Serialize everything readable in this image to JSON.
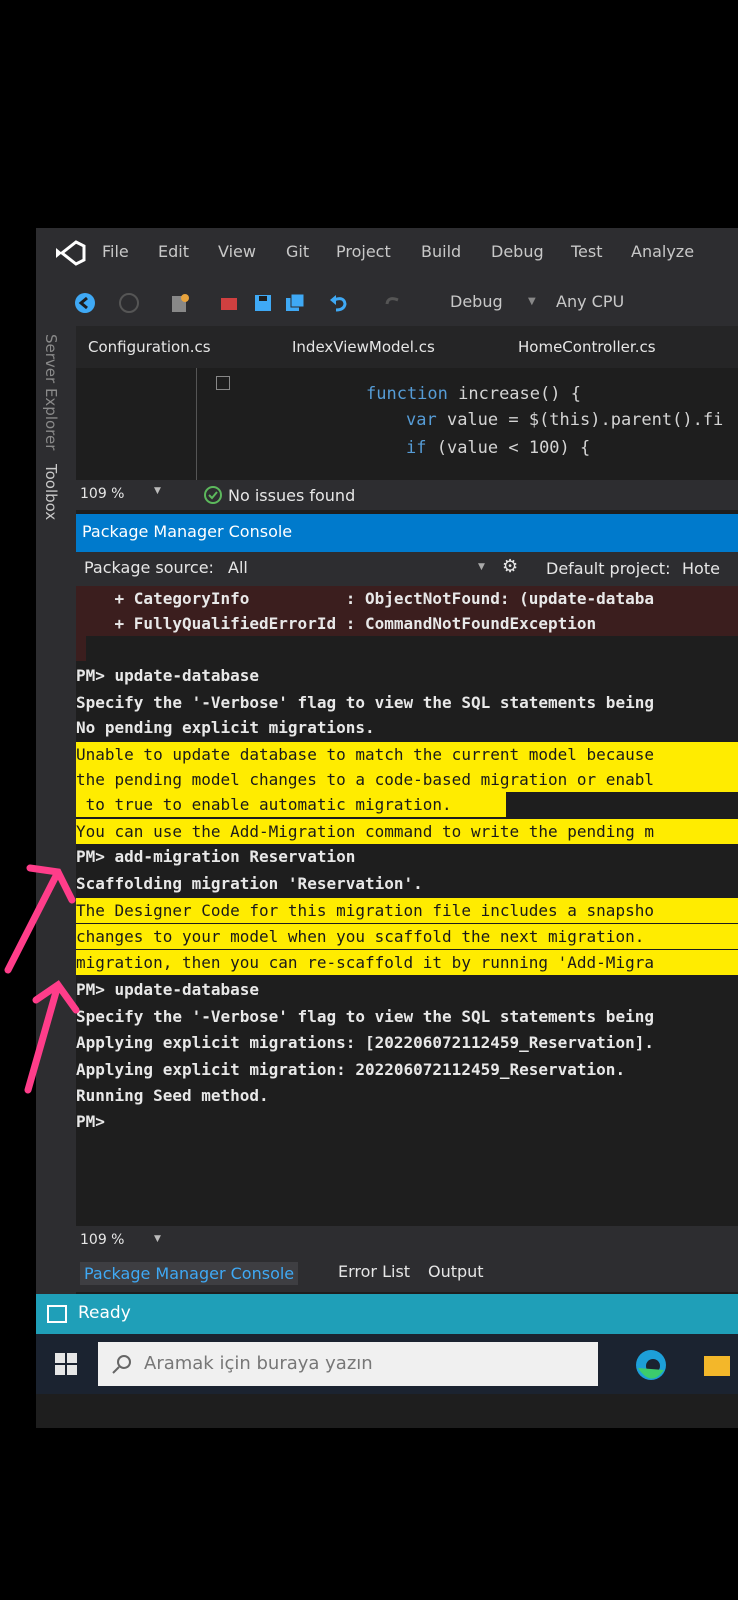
{
  "menu": [
    "File",
    "Edit",
    "View",
    "Git",
    "Project",
    "Build",
    "Debug",
    "Test",
    "Analyze"
  ],
  "toolbar": {
    "config": "Debug",
    "platform": "Any CPU"
  },
  "left_strip": {
    "server_explorer": "Server Explorer",
    "toolbox": "Toolbox"
  },
  "doc_tabs": [
    "Configuration.cs",
    "IndexViewModel.cs",
    "HomeController.cs"
  ],
  "code": {
    "line1": {
      "kw": "function",
      "rest": " increase() {"
    },
    "line2": {
      "kw": "var",
      "rest": " value = $(this).parent().fi"
    },
    "line3": {
      "kw": "if",
      "rest": " (value < 100) {"
    }
  },
  "editor_status": {
    "zoom": "109 %",
    "issues": "No issues found"
  },
  "pmc": {
    "title": "Package Manager Console",
    "source_label": "Package source:",
    "source_value": "All",
    "default_project_label": "Default project:",
    "default_project_value": "Hote"
  },
  "console_lines": [
    {
      "kind": "err",
      "text": "    + CategoryInfo          : ObjectNotFound: (update-databa"
    },
    {
      "kind": "err",
      "text": "    + FullyQualifiedErrorId : CommandNotFoundException"
    },
    {
      "kind": "err",
      "text": " "
    },
    {
      "kind": "norm",
      "text": "PM> update-database"
    },
    {
      "kind": "norm",
      "text": "Specify the '-Verbose' flag to view the SQL statements being"
    },
    {
      "kind": "norm",
      "text": "No pending explicit migrations."
    },
    {
      "kind": "warn",
      "text": "Unable to update database to match the current model because"
    },
    {
      "kind": "warn",
      "text": "the pending model changes to a code-based migration or enabl"
    },
    {
      "kind": "warn",
      "text": " to true to enable automatic migration."
    },
    {
      "kind": "warn",
      "text": "You can use the Add-Migration command to write the pending m"
    },
    {
      "kind": "norm",
      "text": "PM> add-migration Reservation"
    },
    {
      "kind": "norm",
      "text": "Scaffolding migration 'Reservation'."
    },
    {
      "kind": "warn",
      "text": "The Designer Code for this migration file includes a snapsho"
    },
    {
      "kind": "warn",
      "text": "changes to your model when you scaffold the next migration."
    },
    {
      "kind": "warn",
      "text": "migration, then you can re-scaffold it by running 'Add-Migra"
    },
    {
      "kind": "norm",
      "text": "PM> update-database"
    },
    {
      "kind": "norm",
      "text": "Specify the '-Verbose' flag to view the SQL statements being"
    },
    {
      "kind": "norm",
      "text": "Applying explicit migrations: [202206072112459_Reservation]."
    },
    {
      "kind": "norm",
      "text": "Applying explicit migration: 202206072112459_Reservation."
    },
    {
      "kind": "norm",
      "text": "Running Seed method."
    },
    {
      "kind": "norm",
      "text": "PM>"
    }
  ],
  "pmc_zoom": "109 %",
  "bottom_tabs": [
    "Package Manager Console",
    "Error List",
    "Output"
  ],
  "status": {
    "ready": "Ready"
  },
  "taskbar": {
    "search_placeholder": "Aramak için buraya yazın"
  },
  "colors": {
    "accent": "#007acc",
    "status_bar": "#1f9fb8",
    "warning_highlight": "#ffec00",
    "annotation_arrow": "#ff3d8a"
  }
}
